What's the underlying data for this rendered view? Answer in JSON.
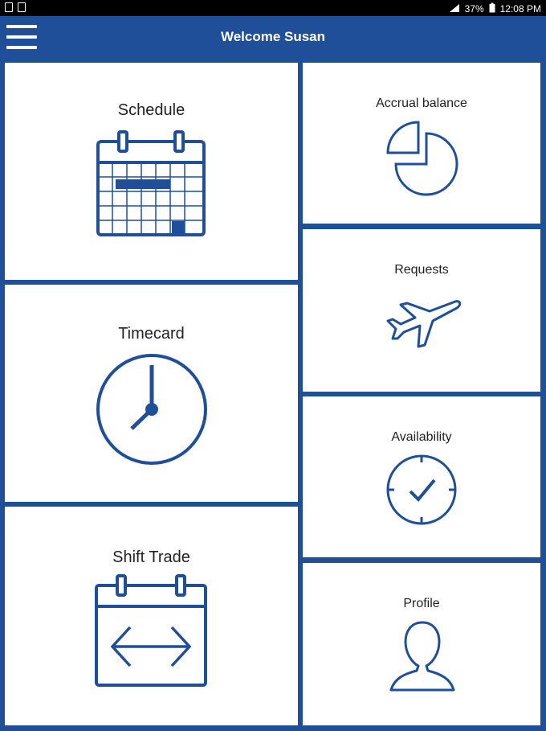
{
  "status_bar": {
    "battery_percent": "37%",
    "time": "12:08 PM"
  },
  "app_bar": {
    "title": "Welcome Susan",
    "menu_icon": "hamburger-icon"
  },
  "tiles": {
    "schedule": {
      "label": "Schedule",
      "icon": "calendar-icon"
    },
    "timecard": {
      "label": "Timecard",
      "icon": "clock-icon"
    },
    "shift_trade": {
      "label": "Shift Trade",
      "icon": "calendar-arrows-icon"
    },
    "accrual_balance": {
      "label": "Accrual balance",
      "icon": "pie-chart-icon"
    },
    "requests": {
      "label": "Requests",
      "icon": "airplane-icon"
    },
    "availability": {
      "label": "Availability",
      "icon": "clock-check-icon"
    },
    "profile": {
      "label": "Profile",
      "icon": "person-icon"
    }
  },
  "colors": {
    "brand": "#1f4f98",
    "tile_background": "#ffffff"
  }
}
